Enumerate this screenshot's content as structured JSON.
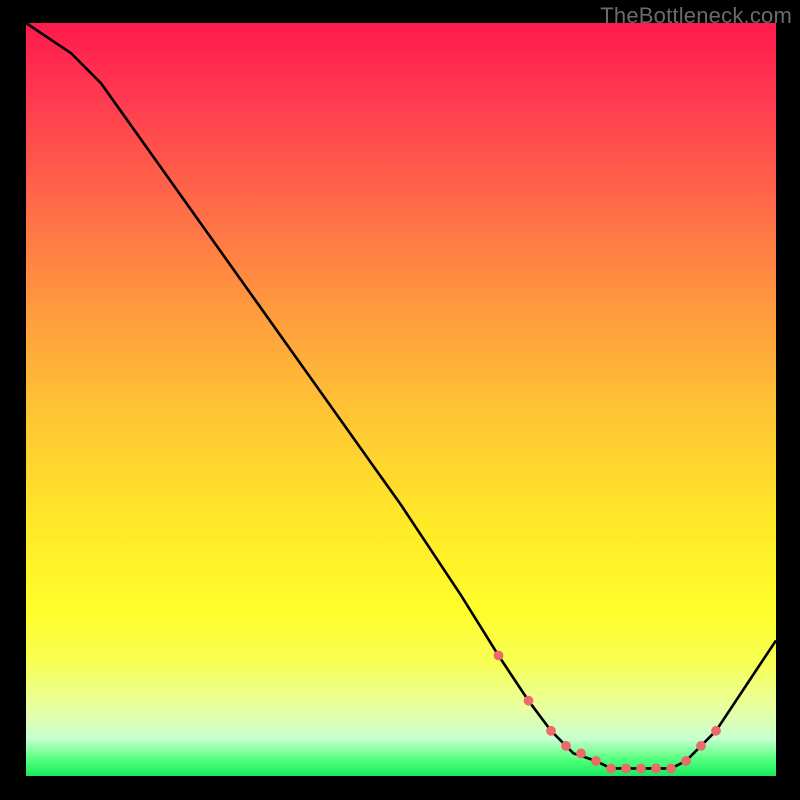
{
  "attribution": "TheBottleneck.com",
  "colors": {
    "background": "#000000",
    "gradient_top": "#ff1a4d",
    "gradient_bottom": "#19e85e",
    "curve": "#000000",
    "marker": "#ec6a6a"
  },
  "chart_data": {
    "type": "line",
    "title": "",
    "xlabel": "",
    "ylabel": "",
    "xlim": [
      0,
      100
    ],
    "ylim": [
      0,
      100
    ],
    "series": [
      {
        "name": "bottleneck-curve",
        "x": [
          0,
          6,
          10,
          20,
          30,
          40,
          50,
          58,
          63,
          67,
          70,
          73,
          76,
          78,
          80,
          82,
          84,
          86,
          88,
          92,
          96,
          100
        ],
        "y": [
          100,
          96,
          92,
          78,
          64,
          50,
          36,
          24,
          16,
          10,
          6,
          3,
          2,
          1,
          1,
          1,
          1,
          1,
          2,
          6,
          12,
          18
        ]
      }
    ],
    "markers": {
      "name": "highlight-points",
      "x": [
        63,
        67,
        70,
        72,
        74,
        76,
        78,
        80,
        82,
        84,
        86,
        88,
        90,
        92
      ],
      "y": [
        16,
        10,
        6,
        4,
        3,
        2,
        1,
        1,
        1,
        1,
        1,
        2,
        4,
        6
      ]
    }
  }
}
